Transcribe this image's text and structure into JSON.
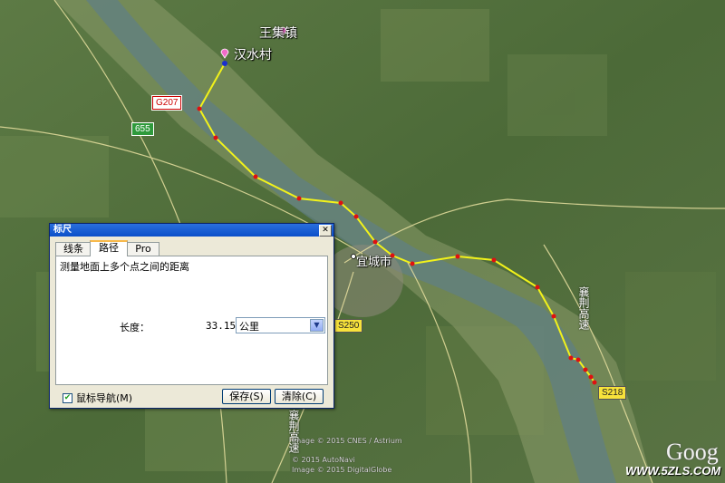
{
  "map": {
    "places": {
      "hanshui": "汉水村",
      "wangji": "王集镇",
      "yicheng": "宜城市"
    },
    "roads": {
      "g207": "G207",
      "s255": "655",
      "s250": "S250",
      "s218": "S218",
      "expressway_east": "襄荆高速",
      "expressway_south": "襄荆高速"
    },
    "route_color": "#f2f21a",
    "point_color": "#e01010",
    "credits": [
      "Image © 2015 CNES / Astrium",
      "© 2015 AutoNavi",
      "Image © 2015 DigitalGlobe"
    ],
    "logo": "Goog",
    "watermark": "WWW.5ZLS.COM"
  },
  "ruler": {
    "title": "标尺",
    "close": "✕",
    "tabs": [
      {
        "label": "线条",
        "active": false
      },
      {
        "label": "路径",
        "active": true
      },
      {
        "label": "Pro",
        "active": false
      }
    ],
    "description": "测量地面上多个点之间的距离",
    "length_label": "长度：",
    "length_value": "33.15",
    "unit": "公里",
    "mouse_nav_label": "鼠标导航(M)",
    "mouse_nav_checked": true,
    "save_button": "保存(S)",
    "clear_button": "清除(C)"
  }
}
